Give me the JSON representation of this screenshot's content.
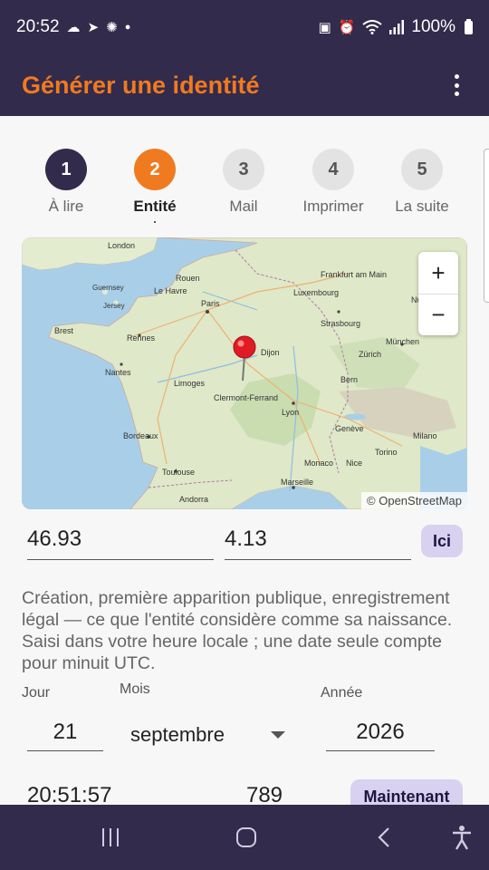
{
  "status": {
    "time": "20:52",
    "battery": "100%"
  },
  "app": {
    "title": "Générer une identité"
  },
  "stepper": {
    "steps": [
      {
        "number": "1",
        "label": "À lire"
      },
      {
        "number": "2",
        "label": "Entité"
      },
      {
        "number": "3",
        "label": "Mail"
      },
      {
        "number": "4",
        "label": "Imprimer"
      },
      {
        "number": "5",
        "label": "La suite"
      }
    ]
  },
  "map": {
    "attribution": "© OpenStreetMap",
    "zoom_in": "+",
    "zoom_out": "−",
    "places": {
      "paris": "Paris",
      "lyon": "Lyon",
      "bordeaux": "Bordeaux",
      "toulouse": "Toulouse",
      "marseille": "Marseille",
      "nantes": "Nantes",
      "rennes": "Rennes",
      "london": "London",
      "frankfurt": "Frankfurt am Main",
      "munchen": "München",
      "zurich": "Zürich",
      "geneve": "Genève",
      "milano": "Milano",
      "torino": "Torino",
      "strasbourg": "Strasbourg",
      "luxembourg": "Luxembourg",
      "clermont": "Clermont-Ferrand",
      "limoges": "Limoges",
      "nice": "Nice",
      "monaco": "Monaco",
      "andorra": "Andorra",
      "nurnberg": "Nürnberg",
      "lehavre": "Le Havre",
      "rouen": "Rouen",
      "brest": "Brest",
      "dijon": "Dijon",
      "bern": "Bern",
      "guernsey": "Guernsey",
      "jersey": "Jersey"
    }
  },
  "location": {
    "latitude": "46.93",
    "longitude": "4.13",
    "here_label": "Ici"
  },
  "description": "Création, première apparition publique, enregistrement légal — ce que l'entité considère comme sa naissance. Saisi dans votre heure locale ; une date seule compte pour minuit UTC.",
  "date": {
    "day_label": "Jour",
    "month_label": "Mois",
    "year_label": "Année",
    "day": "21",
    "month": "septembre",
    "year": "2026"
  },
  "time": {
    "value": "20:51:57",
    "ms": "789",
    "now_label": "Maintenant"
  },
  "colors": {
    "bar": "#322b4c",
    "accent": "#f07a20",
    "chip": "#d8d1ef"
  }
}
